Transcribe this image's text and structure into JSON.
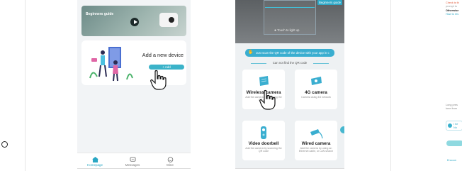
{
  "phone1": {
    "banner_label": "Beginners guide",
    "add_title": "Add a new device",
    "add_button": "+ Add",
    "tabs": [
      {
        "label": "Homepage",
        "icon": "home-icon",
        "active": true
      },
      {
        "label": "Messages",
        "icon": "message-icon",
        "active": false
      },
      {
        "label": "Mine",
        "icon": "smile-icon",
        "active": false
      }
    ]
  },
  "phone2": {
    "torch_label": "Touch to light up",
    "beginners_badge": "Beginners guide",
    "scan_instruction": "Just scan the QR code of the device with your app in c",
    "cant_find": "Can not find the QR code",
    "devices": [
      {
        "name": "Wireless camera",
        "desc": "Add the camera by scanning the QR code",
        "icon": "wireless-camera-icon"
      },
      {
        "name": "4G camera",
        "desc": "Camera using 4G network",
        "icon": "4g-camera-icon"
      },
      {
        "name": "Video doorbell",
        "desc": "Add the camera by scanning the QR code",
        "icon": "doorbell-icon"
      },
      {
        "name": "Wired camera",
        "desc": "Add the camera by using an Ethernet cable, or LAN search",
        "icon": "wired-camera-icon"
      }
    ]
  },
  "panel3": {
    "red_text": "Check is th",
    "gray_line": "prompt tu",
    "otherwise": "Otherwise",
    "howto": "How to res",
    "long_press_1": "Long pres",
    "long_press_2": "tone from",
    "check_line_1": "I he",
    "check_line_2": "No",
    "bottom_link": "Encoun"
  },
  "colors": {
    "accent": "#3bb3c9",
    "warning": "#e15a3a",
    "background": "#f2f4f6"
  }
}
